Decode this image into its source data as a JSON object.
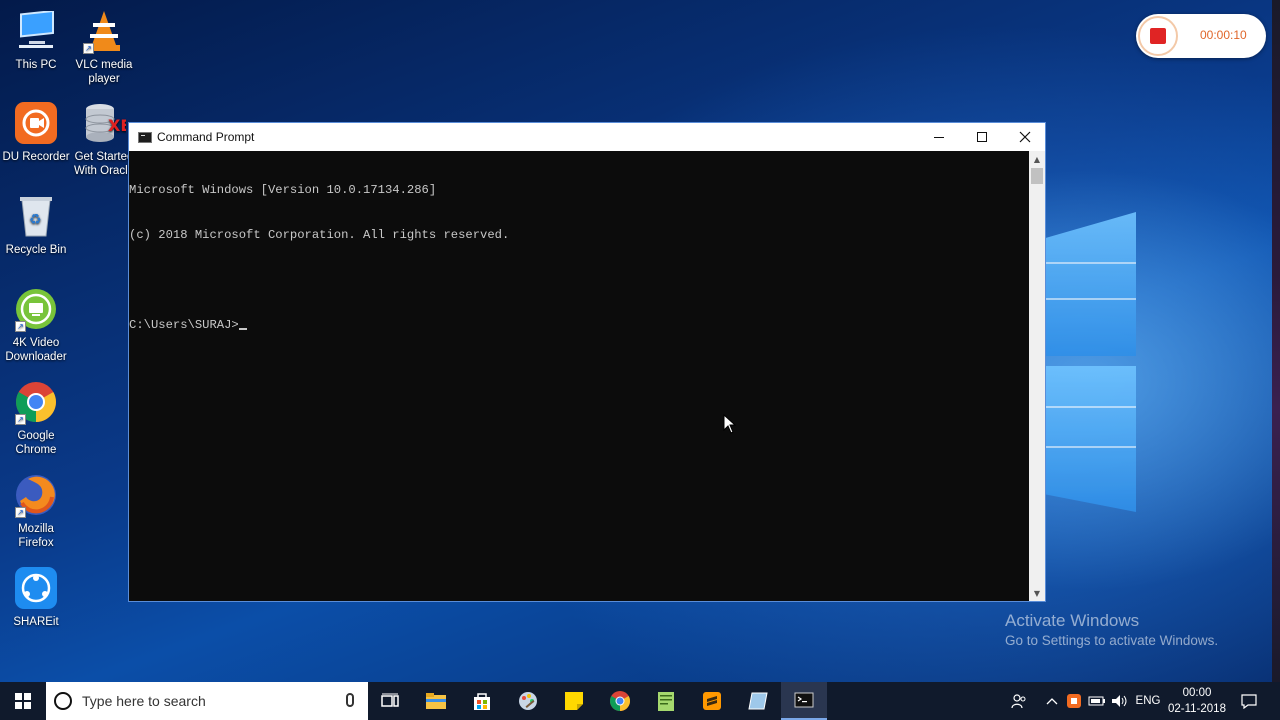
{
  "desktop": {
    "icons": [
      {
        "label": "This PC",
        "icon": "computer-icon"
      },
      {
        "label": "VLC media player",
        "icon": "vlc-cone-icon"
      },
      {
        "label": "DU Recorder",
        "icon": "du-recorder-icon"
      },
      {
        "label": "Get Started With Oracle",
        "icon": "database-icon"
      },
      {
        "label": "Recycle Bin",
        "icon": "recycle-bin-icon"
      },
      {
        "label": "4K Video Downloader",
        "icon": "download-icon"
      },
      {
        "label": "Google Chrome",
        "icon": "chrome-icon"
      },
      {
        "label": "Mozilla Firefox",
        "icon": "firefox-icon"
      },
      {
        "label": "SHAREit",
        "icon": "shareit-icon"
      }
    ],
    "watermark": {
      "title": "Activate Windows",
      "subtitle": "Go to Settings to activate Windows."
    }
  },
  "recorder": {
    "elapsed": "00:00:10",
    "stop_color": "#e02424"
  },
  "window": {
    "title": "Command Prompt",
    "console_lines": [
      "Microsoft Windows [Version 10.0.17134.286]",
      "(c) 2018 Microsoft Corporation. All rights reserved.",
      "",
      "C:\\Users\\SURAJ>"
    ]
  },
  "taskbar": {
    "search_placeholder": "Type here to search",
    "apps": [
      "task-view",
      "file-explorer",
      "store",
      "paint-3d",
      "sticky-notes",
      "chrome",
      "notepad-plus",
      "sublime-text",
      "photos",
      "command-prompt"
    ],
    "tray": {
      "language": "ENG",
      "time": "00:00",
      "date": "02-11-2018"
    }
  },
  "colors": {
    "console_bg": "#0c0c0c",
    "console_fg": "#c8c8c8",
    "taskbar_bg": "#101a2c"
  }
}
